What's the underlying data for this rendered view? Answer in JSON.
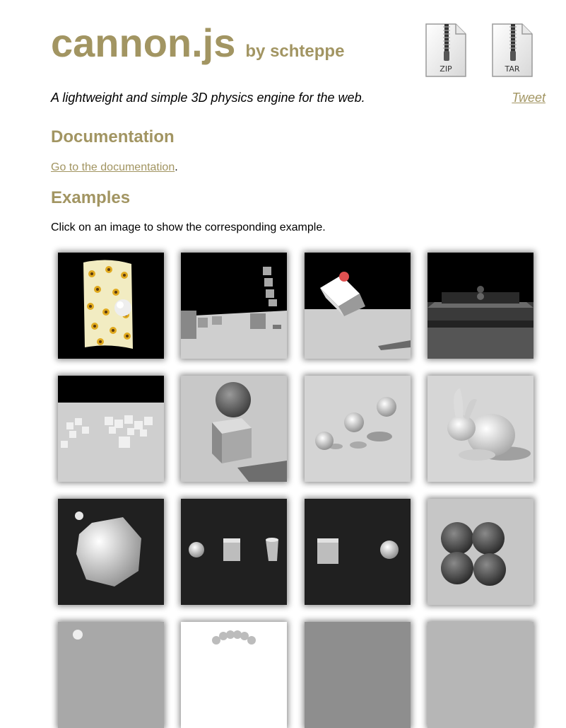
{
  "colors": {
    "accent": "#a29562"
  },
  "header": {
    "title": "cannon.js",
    "byline": "by schteppe",
    "tagline": "A lightweight and simple 3D physics engine for the web.",
    "tweet": "Tweet"
  },
  "downloads": [
    {
      "label": "ZIP",
      "icon": "zip-archive-icon"
    },
    {
      "label": "TAR",
      "icon": "tar-archive-icon"
    }
  ],
  "documentation": {
    "heading": "Documentation",
    "link": "Go to the documentation",
    "suffix": "."
  },
  "examples": {
    "heading": "Examples",
    "intro": "Click on an image to show the corresponding example.",
    "thumbnails": [
      "cloth-sphere",
      "box-tower",
      "falling-box",
      "stacked-walls",
      "box-field",
      "sphere-on-box",
      "bouncing-spheres",
      "bunny",
      "convex-sphere",
      "shapes-row",
      "box-and-sphere",
      "sphere-cluster",
      "small-sphere",
      "sphere-ring",
      "gray-scene",
      "light-scene"
    ]
  }
}
